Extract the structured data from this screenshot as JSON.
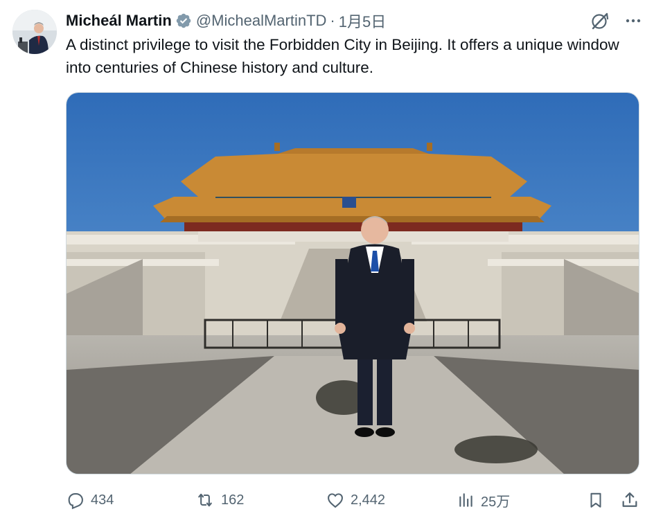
{
  "author": {
    "name": "Micheál Martin",
    "handle": "@MichealMartinTD",
    "separator": "·",
    "date": "1月5日",
    "verified_color": "#829aab"
  },
  "tweet": {
    "text": "A distinct privilege to visit the Forbidden City in Beijing. It offers a unique window into centuries of Chinese history and culture."
  },
  "icons": {
    "grok": "grok-icon",
    "more": "more-icon",
    "reply": "reply-icon",
    "repost": "repost-icon",
    "like": "like-icon",
    "views": "views-icon",
    "bookmark": "bookmark-icon",
    "share": "share-icon"
  },
  "stats": {
    "replies": "434",
    "reposts": "162",
    "likes": "2,442",
    "views": "25万"
  },
  "colors": {
    "text": "#0f1419",
    "secondary": "#536471",
    "sky": "#3d7cc4",
    "roof": "#c98a35"
  }
}
